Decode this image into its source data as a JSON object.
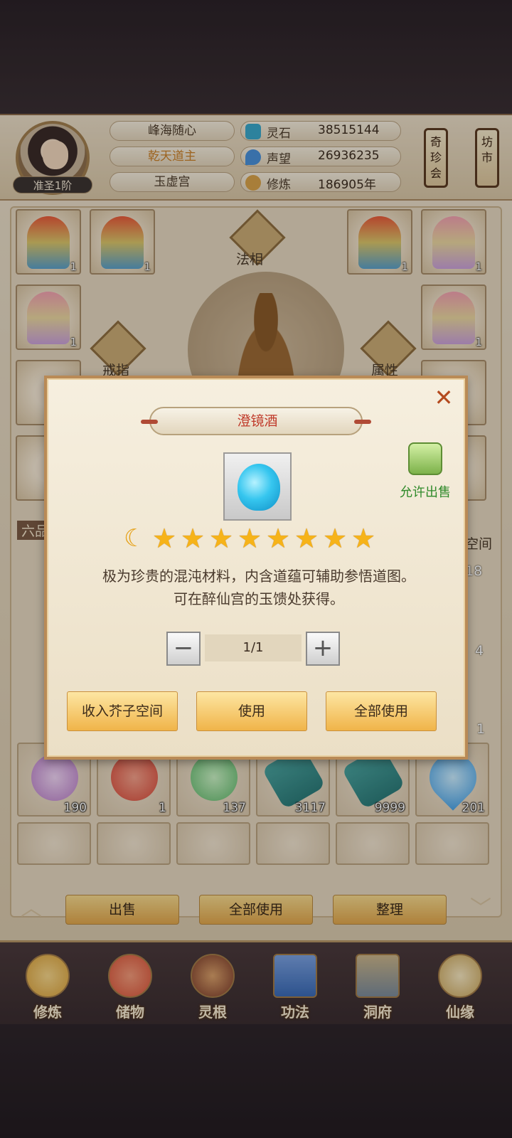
{
  "player": {
    "rank": "准圣1阶",
    "names": [
      "峰海随心",
      "乾天道主",
      "玉虚宫"
    ]
  },
  "resources": [
    {
      "icon": "spirit-stone-icon",
      "label": "灵石",
      "value": "38515144",
      "color": "#3aa7c9"
    },
    {
      "icon": "reputation-icon",
      "label": "声望",
      "value": "26936235",
      "color": "#4a90d9"
    },
    {
      "icon": "cultivation-icon",
      "label": "修炼",
      "value": "186905年",
      "color": "#d8a24a"
    }
  ],
  "side_signs": [
    "奇珍会",
    "坊市"
  ],
  "equip": {
    "faxiang_label": "法相",
    "ring_label": "戒指",
    "attr_label": "属性",
    "slot_counts": [
      "1",
      "1",
      "1",
      "1",
      "1",
      "1"
    ]
  },
  "inventory": {
    "grade_label": "六品",
    "space_label": "芥子空间",
    "side_counts": [
      "418",
      "4",
      "1"
    ],
    "row_items": [
      {
        "icon": "lotus-icon",
        "count": "190",
        "color": "#b87cc7"
      },
      {
        "icon": "red-orb-icon",
        "count": "1",
        "color": "#d94a3a"
      },
      {
        "icon": "herb-icon",
        "count": "137",
        "color": "#5fb86a"
      },
      {
        "icon": "scroll-icon",
        "count": "3117",
        "color": "#2d7c7a"
      },
      {
        "icon": "scroll-icon",
        "count": "9999",
        "color": "#2d7c7a"
      },
      {
        "icon": "water-drop-icon",
        "count": "201",
        "color": "#4aa3e6"
      }
    ]
  },
  "actions": {
    "sell": "出售",
    "use_all": "全部使用",
    "organize": "整理"
  },
  "nav": [
    {
      "label": "修炼",
      "icon": "cultivate-icon",
      "color": "#d9a13a"
    },
    {
      "label": "储物",
      "icon": "storage-bag-icon",
      "color": "#d9543a"
    },
    {
      "label": "灵根",
      "icon": "spirit-root-icon",
      "color": "#7a3a2a"
    },
    {
      "label": "功法",
      "icon": "technique-book-icon",
      "color": "#3a6ab5"
    },
    {
      "label": "洞府",
      "icon": "cave-house-icon",
      "color": "#7a8a9a"
    },
    {
      "label": "仙缘",
      "icon": "fate-icon",
      "color": "#c9a55a"
    }
  ],
  "modal": {
    "title": "澄镜酒",
    "sell_permit": "允许出售",
    "star_count": 8,
    "description_line1": "极为珍贵的混沌材料，内含道蕴可辅助参悟道图。",
    "description_line2": "可在醉仙宫的玉馈处获得。",
    "quantity": "1/1",
    "buttons": {
      "store": "收入芥子空间",
      "use": "使用",
      "use_all": "全部使用"
    }
  }
}
